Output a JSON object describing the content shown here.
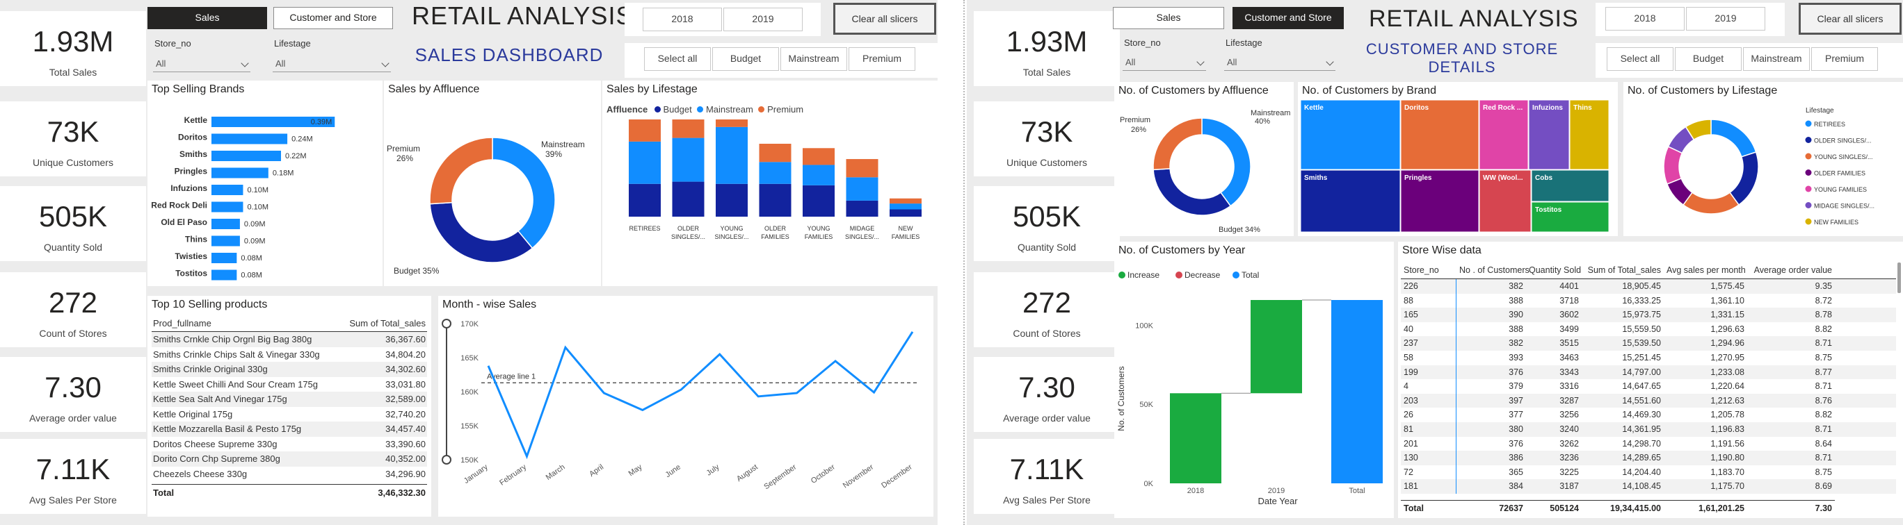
{
  "colors": {
    "budget": "#12239e",
    "mainstream": "#118dff",
    "premium": "#e66c37",
    "bar": "#118dff",
    "increase": "#1aab40",
    "decrease": "#d64550",
    "total": "#118dff"
  },
  "kpis": [
    {
      "value": "1.93M",
      "label": "Total Sales"
    },
    {
      "value": "73K",
      "label": "Unique Customers"
    },
    {
      "value": "505K",
      "label": "Quantity Sold"
    },
    {
      "value": "272",
      "label": "Count of Stores"
    },
    {
      "value": "7.30",
      "label": "Average order value"
    },
    {
      "value": "7.11K",
      "label": "Avg Sales Per Store"
    }
  ],
  "nav": {
    "sales": "Sales",
    "customer": "Customer and Store",
    "title": "RETAIL ANALYSIS",
    "y2018": "2018",
    "y2019": "2019",
    "clear": "Clear all slicers",
    "select_all": "Select all",
    "budget": "Budget",
    "mainstream": "Mainstream",
    "premium": "Premium"
  },
  "filters": {
    "store_label": "Store_no",
    "store_value": "All",
    "life_label": "Lifestage",
    "life_value": "All"
  },
  "sales": {
    "subtitle": "SALES DASHBOARD",
    "brands_title": "Top Selling Brands",
    "brands": [
      {
        "name": "Kettle",
        "value": 0.39,
        "label": "0.39M"
      },
      {
        "name": "Doritos",
        "value": 0.24,
        "label": "0.24M"
      },
      {
        "name": "Smiths",
        "value": 0.22,
        "label": "0.22M"
      },
      {
        "name": "Pringles",
        "value": 0.18,
        "label": "0.18M"
      },
      {
        "name": "Infuzions",
        "value": 0.1,
        "label": "0.10M"
      },
      {
        "name": "Red Rock Deli",
        "value": 0.1,
        "label": "0.10M"
      },
      {
        "name": "Old El Paso",
        "value": 0.09,
        "label": "0.09M"
      },
      {
        "name": "Thins",
        "value": 0.09,
        "label": "0.09M"
      },
      {
        "name": "Twisties",
        "value": 0.08,
        "label": "0.08M"
      },
      {
        "name": "Tostitos",
        "value": 0.08,
        "label": "0.08M"
      }
    ],
    "affluence_title": "Sales by Affluence",
    "affluence": [
      {
        "name": "Mainstream",
        "pct": 39,
        "label": "Mainstream 39%"
      },
      {
        "name": "Budget",
        "pct": 35,
        "label": "Budget 35%"
      },
      {
        "name": "Premium",
        "pct": 26,
        "label": "Premium 26%"
      }
    ],
    "lifestage_title": "Sales by Lifestage",
    "affluence_legend": "Affluence",
    "lifestage_cats": [
      "RETIREES",
      "OLDER SINGLES/...",
      "YOUNG SINGLES/...",
      "OLDER FAMILIES",
      "YOUNG FAMILIES",
      "MIDAGE SINGLES/...",
      "NEW FAMILIES"
    ],
    "lifestage_series": [
      {
        "name": "Budget",
        "values": [
          0.45,
          0.48,
          0.45,
          0.45,
          0.43,
          0.22,
          0.1
        ]
      },
      {
        "name": "Mainstream",
        "values": [
          0.58,
          0.6,
          0.78,
          0.3,
          0.28,
          0.32,
          0.08
        ]
      },
      {
        "name": "Premium",
        "values": [
          0.38,
          0.38,
          0.22,
          0.25,
          0.23,
          0.25,
          0.07
        ]
      }
    ],
    "products_title": "Top 10 Selling products",
    "products_headers": [
      "Prod_fullname",
      "Sum of Total_sales"
    ],
    "products": [
      [
        "Smiths Crnkle Chip Orgnl Big Bag 380g",
        "36,367.60"
      ],
      [
        "Smiths Crinkle Chips Salt & Vinegar 330g",
        "34,804.20"
      ],
      [
        "Smiths Crinkle Original 330g",
        "34,302.60"
      ],
      [
        "Kettle Sweet Chilli And Sour Cream 175g",
        "33,031.80"
      ],
      [
        "Kettle Sea Salt And Vinegar 175g",
        "32,589.00"
      ],
      [
        "Kettle Original 175g",
        "32,740.20"
      ],
      [
        "Kettle Mozzarella Basil & Pesto 175g",
        "34,457.40"
      ],
      [
        "Doritos Cheese Supreme 330g",
        "33,390.60"
      ],
      [
        "Dorito Corn Chp Supreme 380g",
        "40,352.00"
      ],
      [
        "Cheezels Cheese 330g",
        "34,296.90"
      ]
    ],
    "products_total": [
      "Total",
      "3,46,332.30"
    ],
    "monthly_title": "Month - wise Sales",
    "avg_line_label": "Average line 1",
    "monthly": {
      "months": [
        "January",
        "February",
        "March",
        "April",
        "May",
        "June",
        "July",
        "August",
        "September",
        "October",
        "November",
        "December"
      ],
      "values": [
        163800,
        150500,
        166500,
        159800,
        157300,
        160300,
        165500,
        159300,
        159800,
        164500,
        159900,
        168800
      ],
      "yticks": [
        "150K",
        "155K",
        "160K",
        "165K",
        "170K"
      ],
      "ylim": [
        150000,
        170000
      ],
      "average": 161300
    }
  },
  "customers": {
    "subtitle_line1": "CUSTOMER AND STORE",
    "subtitle_line2": "DETAILS",
    "affluence_title": "No. of Customers by Affluence",
    "affluence": [
      {
        "name": "Mainstream",
        "pct": 40,
        "label": "Mainstream 40%"
      },
      {
        "name": "Budget",
        "pct": 34,
        "label": "Budget 34%"
      },
      {
        "name": "Premium",
        "pct": 26,
        "label": "Premium 26%"
      }
    ],
    "brand_title": "No. of Customers by Brand",
    "brands": [
      {
        "name": "Kettle",
        "color": "#118dff"
      },
      {
        "name": "Doritos",
        "color": "#e66c37"
      },
      {
        "name": "Red Rock ...",
        "color": "#e044a7"
      },
      {
        "name": "Infuzions",
        "color": "#744ec2"
      },
      {
        "name": "Thins",
        "color": "#d9b300"
      },
      {
        "name": "Smiths",
        "color": "#12239e"
      },
      {
        "name": "Pringles",
        "color": "#6b007b"
      },
      {
        "name": "WW (Wool...",
        "color": "#d64550"
      },
      {
        "name": "Cobs",
        "color": "#197278"
      },
      {
        "name": "Tostitos",
        "color": "#1aab40"
      }
    ],
    "lifestage_title": "No. of Customers by Lifestage",
    "lifestage_legend_title": "Lifestage",
    "lifestage": [
      {
        "name": "RETIREES",
        "color": "#118dff",
        "pct": 20
      },
      {
        "name": "OLDER SINGLES/...",
        "color": "#12239e",
        "pct": 20
      },
      {
        "name": "YOUNG SINGLES/...",
        "color": "#e66c37",
        "pct": 20
      },
      {
        "name": "OLDER FAMILIES",
        "color": "#6b007b",
        "pct": 9
      },
      {
        "name": "YOUNG FAMILIES",
        "color": "#e044a7",
        "pct": 13
      },
      {
        "name": "MIDAGE SINGLES/...",
        "color": "#744ec2",
        "pct": 9
      },
      {
        "name": "NEW FAMILIES",
        "color": "#d9b300",
        "pct": 9
      }
    ],
    "year_title": "No. of Customers by Year",
    "year_legend": [
      "Increase",
      "Decrease",
      "Total"
    ],
    "year_x": [
      "2018",
      "2019",
      "Total"
    ],
    "year_ylabel": "No. of Customers",
    "year_xlabel": "Date Year",
    "year_yticks": [
      "0K",
      "50K",
      "100K"
    ],
    "year_values": [
      {
        "label": "2018",
        "start": 0,
        "end": 57000
      },
      {
        "label": "2019",
        "start": 57000,
        "end": 116000
      },
      {
        "label": "Total",
        "start": 0,
        "end": 116000
      }
    ],
    "year_ylim": [
      0,
      116000
    ],
    "store_title": "Store Wise data",
    "store_headers": [
      "Store_no",
      "No . of Customers",
      "Quantity Sold",
      "Sum of Total_sales",
      "Avg sales per month",
      "Average order value"
    ],
    "store_rows": [
      [
        "226",
        "382",
        "4401",
        "18,905.45",
        "1,575.45",
        "9.35"
      ],
      [
        "88",
        "388",
        "3718",
        "16,333.25",
        "1,361.10",
        "8.72"
      ],
      [
        "165",
        "390",
        "3602",
        "15,973.75",
        "1,331.15",
        "8.78"
      ],
      [
        "40",
        "388",
        "3499",
        "15,559.50",
        "1,296.63",
        "8.82"
      ],
      [
        "237",
        "382",
        "3515",
        "15,539.50",
        "1,294.96",
        "8.71"
      ],
      [
        "58",
        "393",
        "3463",
        "15,251.45",
        "1,270.95",
        "8.75"
      ],
      [
        "199",
        "376",
        "3343",
        "14,797.00",
        "1,233.08",
        "8.77"
      ],
      [
        "4",
        "379",
        "3316",
        "14,647.65",
        "1,220.64",
        "8.71"
      ],
      [
        "203",
        "397",
        "3287",
        "14,551.60",
        "1,212.63",
        "8.76"
      ],
      [
        "26",
        "377",
        "3256",
        "14,469.30",
        "1,205.78",
        "8.82"
      ],
      [
        "81",
        "380",
        "3240",
        "14,361.95",
        "1,196.83",
        "8.71"
      ],
      [
        "201",
        "376",
        "3262",
        "14,298.70",
        "1,191.56",
        "8.64"
      ],
      [
        "130",
        "386",
        "3236",
        "14,289.65",
        "1,190.80",
        "8.71"
      ],
      [
        "72",
        "365",
        "3225",
        "14,204.40",
        "1,183.70",
        "8.75"
      ],
      [
        "181",
        "384",
        "3187",
        "14,108.45",
        "1,175.70",
        "8.69"
      ]
    ],
    "store_total": [
      "Total",
      "72637",
      "505124",
      "19,34,415.00",
      "1,61,201.25",
      "7.30"
    ]
  }
}
